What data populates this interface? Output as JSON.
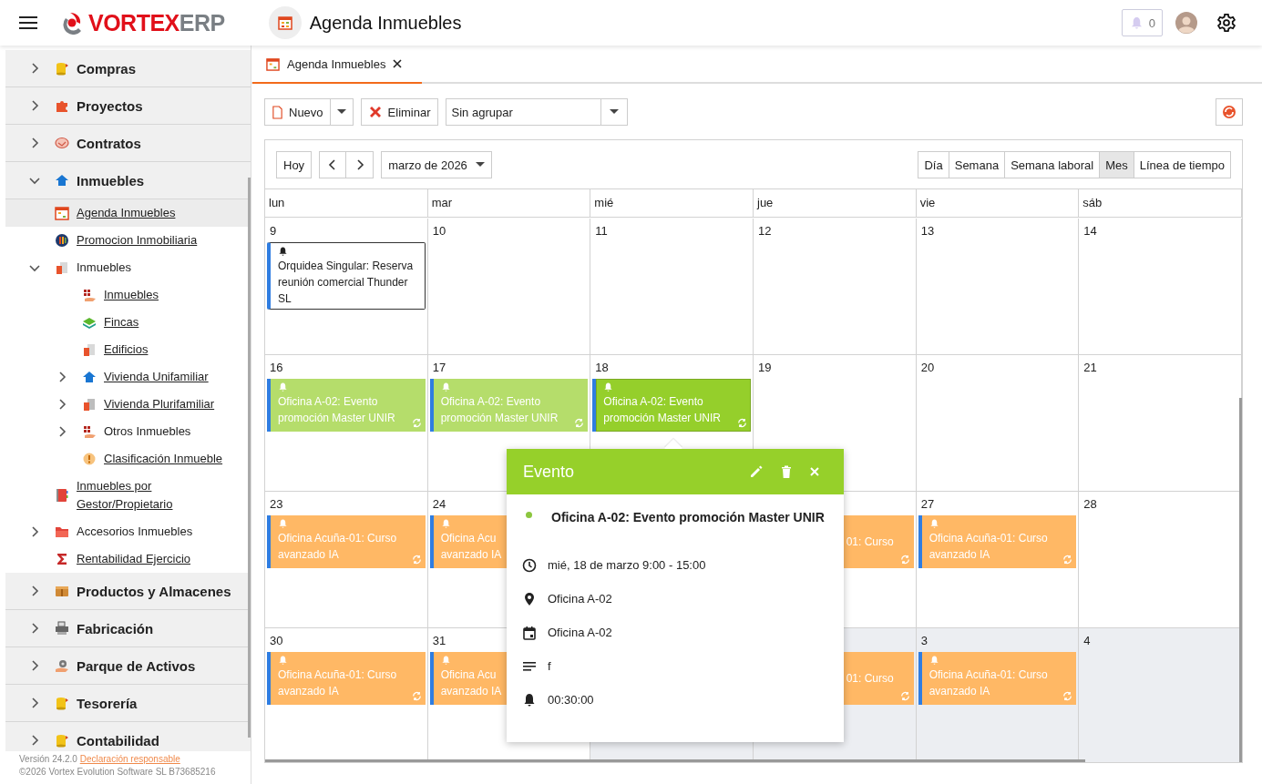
{
  "header": {
    "logo": {
      "brand": "VORTEX",
      "suffix": "ERP"
    },
    "title": "Agenda Inmuebles",
    "notifications": "0"
  },
  "sidebar": {
    "items": [
      {
        "label": "Compras",
        "expanded": false
      },
      {
        "label": "Proyectos",
        "expanded": false
      },
      {
        "label": "Contratos",
        "expanded": false
      },
      {
        "label": "Inmuebles",
        "expanded": true,
        "children": [
          {
            "label": "Agenda Inmuebles",
            "link": true,
            "selected": true
          },
          {
            "label": "Promocion Inmobiliaria",
            "link": true,
            "selected": false
          },
          {
            "label": "Inmuebles",
            "link": false,
            "selected": false,
            "expanded": true,
            "children": [
              {
                "label": "Inmuebles",
                "link": true,
                "selected": false
              },
              {
                "label": "Fincas",
                "link": true,
                "selected": false
              },
              {
                "label": "Edificios",
                "link": true,
                "selected": false
              },
              {
                "label": "Vivienda Unifamiliar",
                "link": true,
                "selected": false,
                "expanded": false
              },
              {
                "label": "Vivienda Plurifamiliar",
                "link": true,
                "selected": false,
                "expanded": false
              },
              {
                "label": "Otros Inmuebles",
                "link": false,
                "selected": false,
                "expanded": false
              },
              {
                "label": "Clasificación Inmueble",
                "link": true,
                "selected": false
              }
            ]
          },
          {
            "label": "Inmuebles por Gestor/Propietario",
            "link": true,
            "selected": false
          },
          {
            "label": "Accesorios Inmuebles",
            "link": false,
            "selected": false,
            "expanded": false
          },
          {
            "label": "Rentabilidad Ejercicio",
            "link": true,
            "selected": false
          }
        ]
      },
      {
        "label": "Productos y Almacenes",
        "expanded": false
      },
      {
        "label": "Fabricación",
        "expanded": false
      },
      {
        "label": "Parque de Activos",
        "expanded": false
      },
      {
        "label": "Tesorería",
        "expanded": false
      },
      {
        "label": "Contabilidad",
        "expanded": false
      }
    ],
    "footer": {
      "version": "Versión 24.2.0",
      "link": "Declaración responsable",
      "copyright": "©2026 Vortex Evolution Software SL B73685216"
    }
  },
  "tabs": [
    {
      "label": "Agenda Inmuebles",
      "selected": true
    }
  ],
  "toolbar": {
    "new": "Nuevo",
    "delete": "Eliminar",
    "grouping": "Sin agrupar"
  },
  "calendar": {
    "today": "Hoy",
    "period": "marzo de 2026",
    "views": [
      {
        "label": "Día",
        "selected": false
      },
      {
        "label": "Semana",
        "selected": false
      },
      {
        "label": "Semana laboral",
        "selected": false
      },
      {
        "label": "Mes",
        "selected": true
      },
      {
        "label": "Línea de tiempo",
        "selected": false
      }
    ],
    "columns": [
      "lun",
      "mar",
      "mié",
      "jue",
      "vie",
      "sáb"
    ],
    "weeks": [
      {
        "days": [
          {
            "day": "9",
            "other_month": false,
            "events": [
              {
                "kind": "outline",
                "lines": [
                  "Orquidea Singular: Reserva reunión comercial Thunder SL"
                ],
                "reminder": true,
                "recurring": false,
                "selected": false
              }
            ]
          },
          {
            "day": "10",
            "other_month": false
          },
          {
            "day": "11",
            "other_month": false
          },
          {
            "day": "12",
            "other_month": false
          },
          {
            "day": "13",
            "other_month": false
          },
          {
            "day": "14",
            "other_month": false
          }
        ]
      },
      {
        "days": [
          {
            "day": "16",
            "other_month": false,
            "events": [
              {
                "kind": "filled",
                "color": "#b5dd6b",
                "lines": [
                  "Oficina A-02: Evento",
                  "promoción Master UNIR"
                ],
                "reminder": true,
                "recurring": true,
                "selected": false
              }
            ]
          },
          {
            "day": "17",
            "other_month": false,
            "events": [
              {
                "kind": "filled",
                "color": "#b5dd6b",
                "lines": [
                  "Oficina A-02: Evento",
                  "promoción Master UNIR"
                ],
                "reminder": true,
                "recurring": true,
                "selected": false
              }
            ]
          },
          {
            "day": "18",
            "other_month": false,
            "events": [
              {
                "kind": "filled",
                "color": "#95cf2b",
                "lines": [
                  "Oficina A-02: Evento",
                  "promoción Master UNIR"
                ],
                "reminder": true,
                "recurring": true,
                "selected": true
              }
            ]
          },
          {
            "day": "19",
            "other_month": false
          },
          {
            "day": "20",
            "other_month": false
          },
          {
            "day": "21",
            "other_month": false
          }
        ]
      },
      {
        "days": [
          {
            "day": "23",
            "other_month": false,
            "events": [
              {
                "kind": "filled",
                "color": "#ffb865",
                "lines": [
                  "Oficina Acuña-01: Curso",
                  "avanzado IA"
                ],
                "reminder": true,
                "recurring": true,
                "selected": false
              }
            ]
          },
          {
            "day": "24",
            "other_month": false,
            "events": [
              {
                "kind": "filled",
                "color": "#ffb865",
                "lines": [
                  "Oficina Acu",
                  "avanzado IA"
                ],
                "reminder": true,
                "selected": false
              }
            ]
          },
          {
            "other_month": false,
            "events": [
              {
                "kind": "covered",
                "color": "#ffb865",
                "lines": [
                  "01: Curso"
                ],
                "recurring": true,
                "selected": false
              }
            ]
          },
          {
            "day": "27",
            "other_month": false,
            "events": [
              {
                "kind": "filled",
                "color": "#ffb865",
                "lines": [
                  "Oficina Acuña-01: Curso",
                  "avanzado IA"
                ],
                "reminder": true,
                "recurring": true,
                "selected": false
              }
            ]
          },
          {
            "day": "28",
            "other_month": false
          }
        ]
      },
      {
        "days": [
          {
            "day": "30",
            "other_month": false,
            "events": [
              {
                "kind": "filled",
                "color": "#ffb865",
                "lines": [
                  "Oficina Acuña-01: Curso",
                  "avanzado IA"
                ],
                "reminder": true,
                "recurring": true,
                "selected": false
              }
            ]
          },
          {
            "day": "31",
            "other_month": false,
            "events": [
              {
                "kind": "filled",
                "color": "#ffb865",
                "lines": [
                  "Oficina Acu",
                  "avanzado IA"
                ],
                "reminder": true,
                "selected": false
              }
            ]
          },
          {
            "other_month": true
          },
          {
            "other_month": true,
            "events": [
              {
                "kind": "covered",
                "color": "#ffb865",
                "lines": [
                  "01: Curso"
                ],
                "recurring": true,
                "selected": false
              }
            ]
          },
          {
            "day": "3",
            "other_month": true,
            "events": [
              {
                "kind": "filled",
                "color": "#ffb865",
                "lines": [
                  "Oficina Acuña-01: Curso",
                  "avanzado IA"
                ],
                "reminder": true,
                "recurring": true,
                "selected": false
              }
            ]
          },
          {
            "day": "4",
            "other_month": true
          }
        ]
      }
    ]
  },
  "popup": {
    "title": "Evento",
    "event_title": "Oficina A-02: Evento promoción Master UNIR",
    "color": "#8cc63f",
    "details": [
      {
        "kind": "time",
        "text": "mié, 18 de marzo 9:00 - 15:00"
      },
      {
        "kind": "location",
        "text": "Oficina A-02"
      },
      {
        "kind": "calendar",
        "text": "Oficina A-02"
      },
      {
        "kind": "description",
        "text": "f"
      },
      {
        "kind": "reminder",
        "text": "00:30:00"
      }
    ]
  }
}
